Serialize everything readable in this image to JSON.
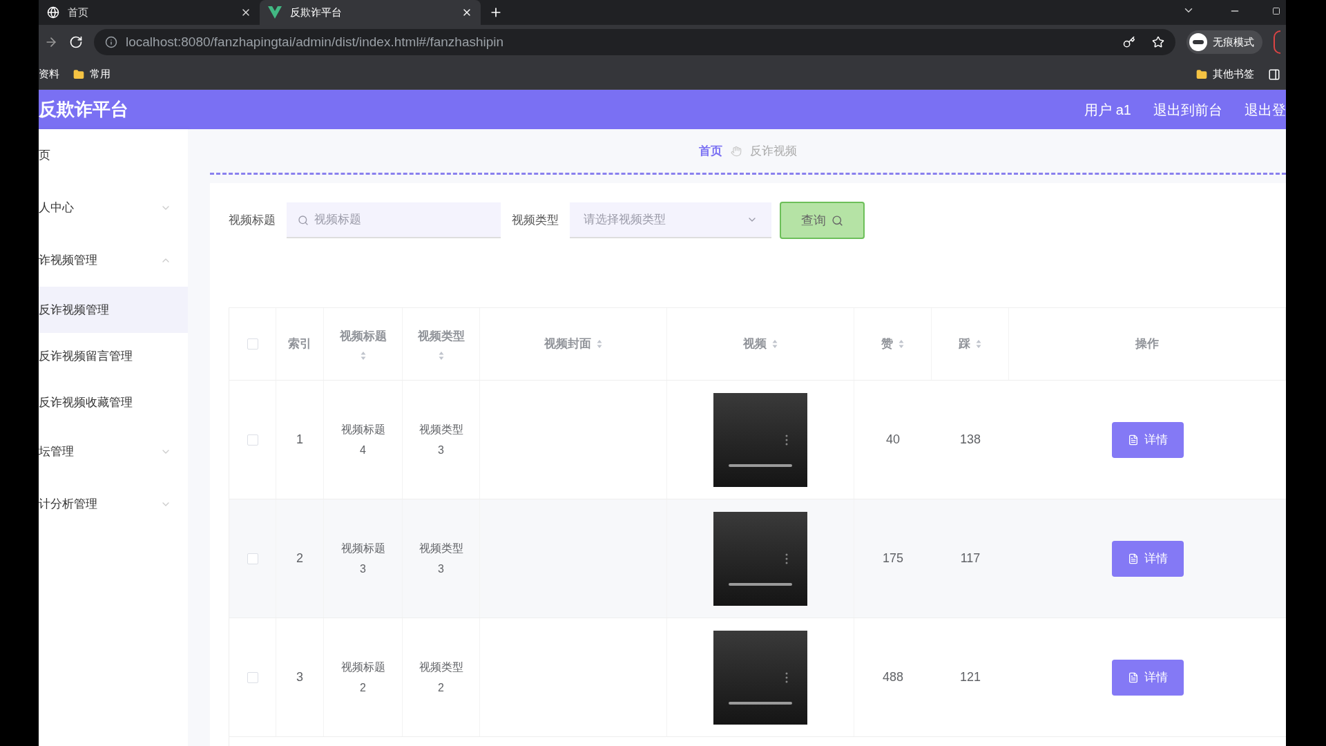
{
  "browser": {
    "tabs": [
      {
        "title": "首页",
        "selected": false
      },
      {
        "title": "反欺诈平台",
        "selected": true
      }
    ],
    "address": "localhost:8080/fanzhapingtai/admin/dist/index.html#/fanzhashipin",
    "incognito_label": "无痕模式",
    "bookmarks_left": [
      "资料",
      "常用"
    ],
    "bookmarks_right": [
      "其他书签"
    ]
  },
  "app": {
    "title": "反欺诈平台",
    "header_links": [
      "用户 a1",
      "退出到前台",
      "退出登"
    ]
  },
  "sidebar": {
    "items": [
      {
        "label": "页",
        "kind": "link"
      },
      {
        "label": "人中心",
        "kind": "group",
        "expanded": false
      },
      {
        "label": "诈视频管理",
        "kind": "group",
        "expanded": true,
        "children": [
          {
            "label": "反诈视频管理",
            "selected": true
          },
          {
            "label": "反诈视频留言管理",
            "selected": false
          },
          {
            "label": "反诈视频收藏管理",
            "selected": false
          }
        ]
      },
      {
        "label": "坛管理",
        "kind": "group",
        "expanded": false
      },
      {
        "label": "计分析管理",
        "kind": "group",
        "expanded": false
      }
    ]
  },
  "breadcrumb": [
    "首页",
    "反诈视频"
  ],
  "search": {
    "fields": [
      {
        "label": "视频标题",
        "placeholder": "视频标题",
        "kind": "text"
      },
      {
        "label": "视频类型",
        "placeholder": "请选择视频类型",
        "kind": "select"
      }
    ],
    "button": "查询"
  },
  "table": {
    "select_all_checked": false,
    "columns": [
      {
        "label": "索引",
        "sortable": false
      },
      {
        "label": "视频标题",
        "sortable": true
      },
      {
        "label": "视频类型",
        "sortable": true
      },
      {
        "label": "视频封面",
        "sortable": true
      },
      {
        "label": "视频",
        "sortable": true
      },
      {
        "label": "赞",
        "sortable": true
      },
      {
        "label": "踩",
        "sortable": true
      },
      {
        "label": "操作",
        "sortable": false
      }
    ],
    "rows": [
      {
        "checked": false,
        "index": "1",
        "title": "视频标题 4",
        "type": "视频类型 3",
        "likes": "40",
        "dislikes": "138",
        "action": "详情"
      },
      {
        "checked": false,
        "index": "2",
        "title": "视频标题 3",
        "type": "视频类型 3",
        "likes": "175",
        "dislikes": "117",
        "action": "详情"
      },
      {
        "checked": false,
        "index": "3",
        "title": "视频标题 2",
        "type": "视频类型 2",
        "likes": "488",
        "dislikes": "121",
        "action": "详情"
      }
    ]
  }
}
